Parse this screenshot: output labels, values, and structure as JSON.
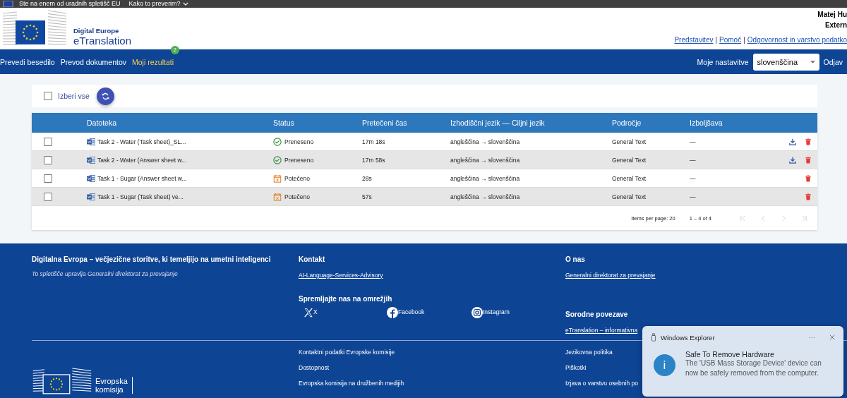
{
  "topbar": {
    "notice": "Ste na enem od uradnih spletišč EU",
    "check_link": "Kako to preverim?"
  },
  "header": {
    "brand_small": "Digital Europe",
    "brand": "eTranslation",
    "user_name": "Matej Hu",
    "user_role": "Extern",
    "link_separator": "|",
    "links": [
      {
        "label": "Predstavitev"
      },
      {
        "label": "Pomoč"
      },
      {
        "label": "Odgovornost in varstvo podatko"
      }
    ]
  },
  "nav": {
    "items": [
      {
        "label": "Prevedi besedilo",
        "selected": false
      },
      {
        "label": "Prevod dokumentov",
        "selected": false
      },
      {
        "label": "Moji rezultati",
        "selected": true,
        "badge": "2"
      }
    ],
    "settings_label": "Moje nastavitve",
    "language": "slovenščina",
    "logout": "Odjav"
  },
  "toolbar": {
    "select_all": "Izberi vse",
    "select_all_checked": false
  },
  "table": {
    "columns": [
      "Datoteka",
      "Status",
      "Pretečeni čas",
      "Izhodiščni jezik — Ciljni jezik",
      "Področje",
      "Izboljšava"
    ],
    "rows": [
      {
        "checked": false,
        "file": "Task 2 - Water (Task sheet)_SL...",
        "kind": "done",
        "status": "Preneseno",
        "time": "17m 18s",
        "langs": "angleščina → slovenščina",
        "domain": "General Text",
        "improvement": "—",
        "downloadable": true
      },
      {
        "checked": false,
        "file": "Task 2 - Water (Answer sheet w...",
        "kind": "done",
        "status": "Preneseno",
        "time": "17m 58s",
        "langs": "angleščina → slovenščina",
        "domain": "General Text",
        "improvement": "—",
        "downloadable": true
      },
      {
        "checked": false,
        "file": "Task 1 - Sugar (Answer sheet w...",
        "kind": "expired",
        "status": "Potečeno",
        "time": "28s",
        "langs": "angleščina → slovenščina",
        "domain": "General Text",
        "improvement": "—",
        "downloadable": false
      },
      {
        "checked": false,
        "file": "Task 1 - Sugar (Task sheet) ve...",
        "kind": "expired",
        "status": "Potečeno",
        "time": "57s",
        "langs": "angleščina → slovenščina",
        "domain": "General Text",
        "improvement": "—",
        "downloadable": false
      }
    ],
    "items_per_page": "Items per page: 20",
    "range": "1 – 4 of 4"
  },
  "footer": {
    "title": "Digitalna Evropa – večjezične storitve, ki temeljijo na umetni inteligenci",
    "subtitle": "To spletišče upravlja Generalni direktorat za prevajanje",
    "contact_heading": "Kontakt",
    "contact_link": "AI-Language-Services-Advisory",
    "social_heading": "Spremljajte nas na omrežjih",
    "socials": [
      {
        "kind": "x",
        "label": "X"
      },
      {
        "kind": "facebook",
        "label": "Facebook"
      },
      {
        "kind": "instagram",
        "label": "Instagram"
      }
    ],
    "about_heading": "O nas",
    "about_link": "Generalni direktorat za prevajanje",
    "related_heading": "Sorodne povezave",
    "related_link": "eTranslation – informativna",
    "logo_text": [
      "Evropska",
      "komisija"
    ],
    "links_col2": [
      "Kontaktni podatki Evropske komisije",
      "Dostopnost",
      "Evropska komisija na družbenih medijih"
    ],
    "links_col3": [
      "Jezikovna politika",
      "Piškotki",
      "Izjava o varstvu osebnih po"
    ]
  },
  "toast": {
    "app": "Windows Explorer",
    "more": "···",
    "title": "Safe To Remove Hardware",
    "body": "The 'USB Mass Storage Device' device can now be safely removed from the computer.",
    "info_glyph": "i"
  }
}
